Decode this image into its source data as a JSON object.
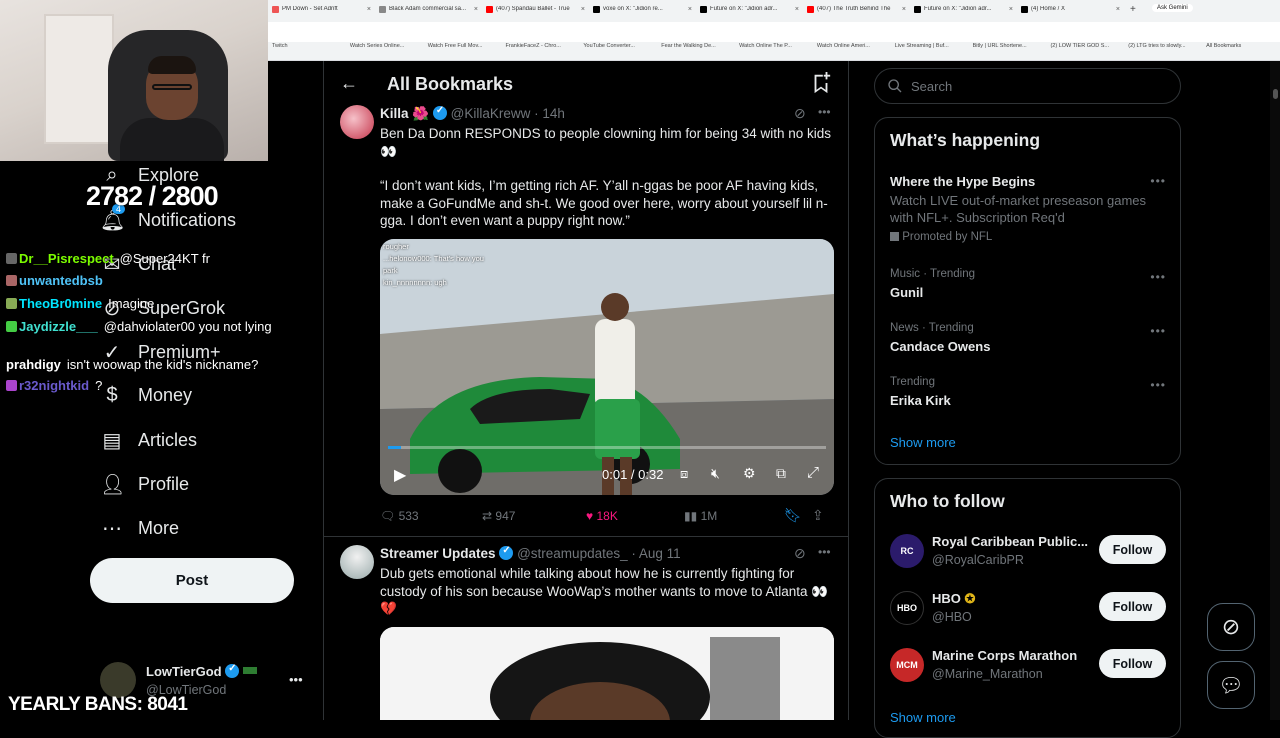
{
  "browser": {
    "tabs": [
      {
        "title": "PM Down - Set Adrift",
        "color": "#e55"
      },
      {
        "title": "Black Adam commercial sa...",
        "color": "#888"
      },
      {
        "title": "(407) Spandau Ballet - True",
        "color": "#f00"
      },
      {
        "title": "voxe on X: \"Jidion re...",
        "color": "#000"
      },
      {
        "title": "Future on X: \"Jidion adr...",
        "color": "#000"
      },
      {
        "title": "(407) The Truth Behind The",
        "color": "#f00"
      },
      {
        "title": "Future on X: \"Jidion adr...",
        "color": "#000"
      },
      {
        "title": "(4) Home / X",
        "color": "#000"
      }
    ],
    "ask_gemini": "Ask Gemini",
    "bookmarks": [
      "Twitch",
      "Watch Series Online...",
      "Watch Free Full Mov...",
      "FrankieFaceZ - Chro...",
      "YouTube Converter...",
      "Fear the Walking De...",
      "Watch Online The P...",
      "Watch Online Ameri...",
      "Live Streaming | Buf...",
      "Bitly | URL Shortene...",
      "(2) LOW TIER GOD S...",
      "(2) LTG tries to slowly...",
      "All Bookmarks"
    ]
  },
  "stream": {
    "counter": "2782 / 2800",
    "bans": "YEARLY BANS: 8041",
    "chat": [
      {
        "user": "Dr__Pisrespect",
        "user_color": "#7cfc00",
        "text": "@Super24KT fr"
      },
      {
        "user": "unwantedbsb",
        "user_color": "#4fc3f7",
        "text": ""
      },
      {
        "user": "TheoBr0mine",
        "user_color": "#00e5ff",
        "text": "Imagine"
      },
      {
        "user": "Jaydizzle___",
        "user_color": "#40e0d0",
        "text": "@dahviolater00 you not lying"
      },
      {
        "user": "prahdigy",
        "user_color": "#ffffff",
        "text": "isn't woowap the kid's nickname?"
      },
      {
        "user": "r32nightkid",
        "user_color": "#6a5acd",
        "text": "?"
      }
    ]
  },
  "sidebar": {
    "items": [
      {
        "label": "Explore",
        "icon": "search-icon"
      },
      {
        "label": "Notifications",
        "icon": "bell-icon",
        "badge": "4"
      },
      {
        "label": "Chat",
        "icon": "chat-icon"
      },
      {
        "label": "SuperGrok",
        "icon": "grok-icon"
      },
      {
        "label": "Premium+",
        "icon": "premium-icon"
      },
      {
        "label": "Money",
        "icon": "money-icon"
      },
      {
        "label": "Articles",
        "icon": "articles-icon"
      },
      {
        "label": "Profile",
        "icon": "profile-icon"
      },
      {
        "label": "More",
        "icon": "more-icon"
      }
    ],
    "post_label": "Post",
    "account": {
      "name": "LowTierGod",
      "handle": "@LowTierGod"
    }
  },
  "main": {
    "title": "All Bookmarks",
    "tweets": [
      {
        "name": "Killa 🌺",
        "handle": "@KillaKreww",
        "time": "14h",
        "text1": "Ben Da Donn RESPONDS to people clowning him for being 34 with no kids 👀",
        "text2": "“I don’t want kids, I’m getting rich AF. Y’all n-ggas be poor AF having kids, make a GoFundMe and sh-t. We good over here, worry about yourself lil n-gga. I don’t even want a puppy right now.”",
        "video": {
          "overlay_lines": [
            "rougher",
            "...helonow000: That's how you",
            "park",
            "kin_nnnnnnnn: ugh"
          ],
          "time": "0:01 / 0:32",
          "progress": 0.03
        },
        "replies": "533",
        "reposts": "947",
        "likes": "18K",
        "views": "1M"
      },
      {
        "name": "Streamer Updates",
        "handle": "@streamupdates_",
        "time": "Aug 11",
        "text1": "Dub gets emotional while talking about how he is currently fighting for custody of his son because WooWap’s mother wants to move to Atlanta 👀 💔"
      }
    ]
  },
  "right": {
    "search_placeholder": "Search",
    "happening_title": "What’s happening",
    "promo": {
      "name": "Where the Hype Begins",
      "text": "Watch LIVE out-of-market preseason games with NFL+. Subscription Req'd",
      "promoted": "Promoted by NFL"
    },
    "trends": [
      {
        "meta": "Music · Trending",
        "name": "Gunil"
      },
      {
        "meta": "News · Trending",
        "name": "Candace Owens"
      },
      {
        "meta": "Trending",
        "name": "Erika Kirk"
      }
    ],
    "show_more": "Show more",
    "who_title": "Who to follow",
    "follow": [
      {
        "name": "Royal Caribbean Public...",
        "handle": "@RoyalCaribPR",
        "avatar_text": "RC",
        "color": "#2b1b6b"
      },
      {
        "name": "HBO",
        "handle": "@HBO",
        "avatar_text": "HBO",
        "color": "#000000"
      },
      {
        "name": "Marine Corps Marathon",
        "handle": "@Marine_Marathon",
        "avatar_text": "MCM",
        "color": "#c62828"
      }
    ],
    "follow_label": "Follow",
    "show_more2": "Show more"
  }
}
